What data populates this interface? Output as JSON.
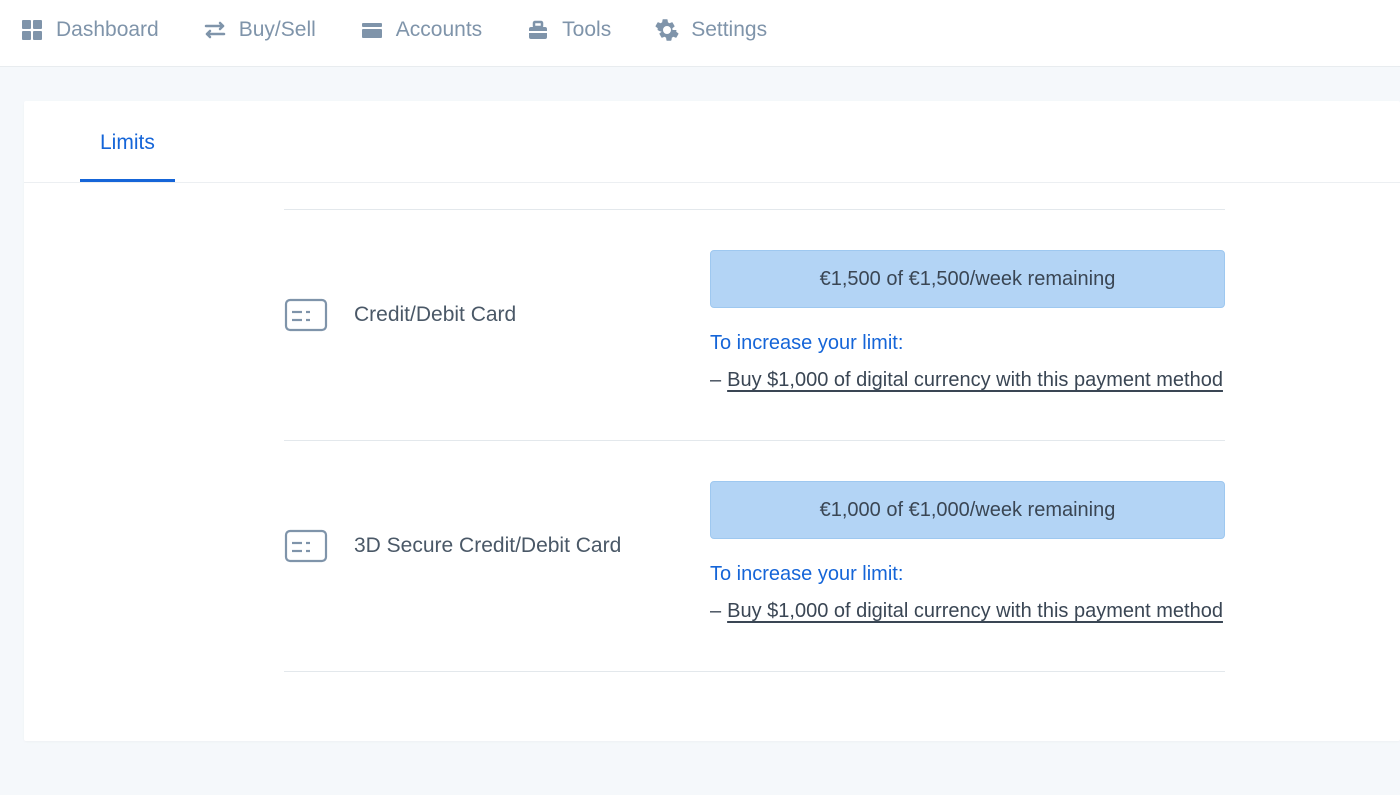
{
  "nav": {
    "items": [
      {
        "label": "Dashboard"
      },
      {
        "label": "Buy/Sell"
      },
      {
        "label": "Accounts"
      },
      {
        "label": "Tools"
      },
      {
        "label": "Settings"
      }
    ]
  },
  "tabs": {
    "active": "Limits"
  },
  "limits": {
    "increase_label": "To increase your limit:",
    "bullet": "–",
    "rows": [
      {
        "title": "Credit/Debit Card",
        "progress_text": "€1,500 of €1,500/week remaining",
        "action_text": "Buy $1,000 of digital currency with this payment method"
      },
      {
        "title": "3D Secure Credit/Debit Card",
        "progress_text": "€1,000 of €1,000/week remaining",
        "action_text": "Buy $1,000 of digital currency with this payment method"
      }
    ]
  },
  "colors": {
    "accent": "#1565d8",
    "nav_text": "#7f94aa",
    "progress_bg": "#b3d4f5"
  }
}
